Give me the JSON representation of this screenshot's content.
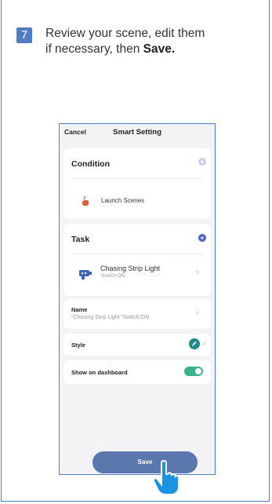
{
  "instruction": {
    "step_number": "7",
    "text_line1": "Review your scene, edit them",
    "text_line2_prefix": "if necessary, then ",
    "text_line2_bold": "Save."
  },
  "phone": {
    "cancel_label": "Cancel",
    "title": "Smart Setting",
    "condition": {
      "title": "Condition",
      "add_icon": "plus-circle-icon",
      "item_label": "Launch Scenes"
    },
    "task": {
      "title": "Task",
      "add_icon": "plus-circle-icon",
      "item_name": "Chasing Strip Light",
      "item_status": "Switch:ON",
      "chevron": "›"
    },
    "name": {
      "label": "Name",
      "value": "\"Chasing Strip Light \"Swtich:ON",
      "chevron": "›"
    },
    "style": {
      "label": "Style",
      "chevron": "›",
      "color": "#1f8a86"
    },
    "show_on_dashboard": {
      "label": "Show on dashboard",
      "enabled": true,
      "color": "#3ab488"
    },
    "save_label": "Save"
  },
  "colors": {
    "accent": "#4f7ec4",
    "save_button": "#5b78ae"
  }
}
